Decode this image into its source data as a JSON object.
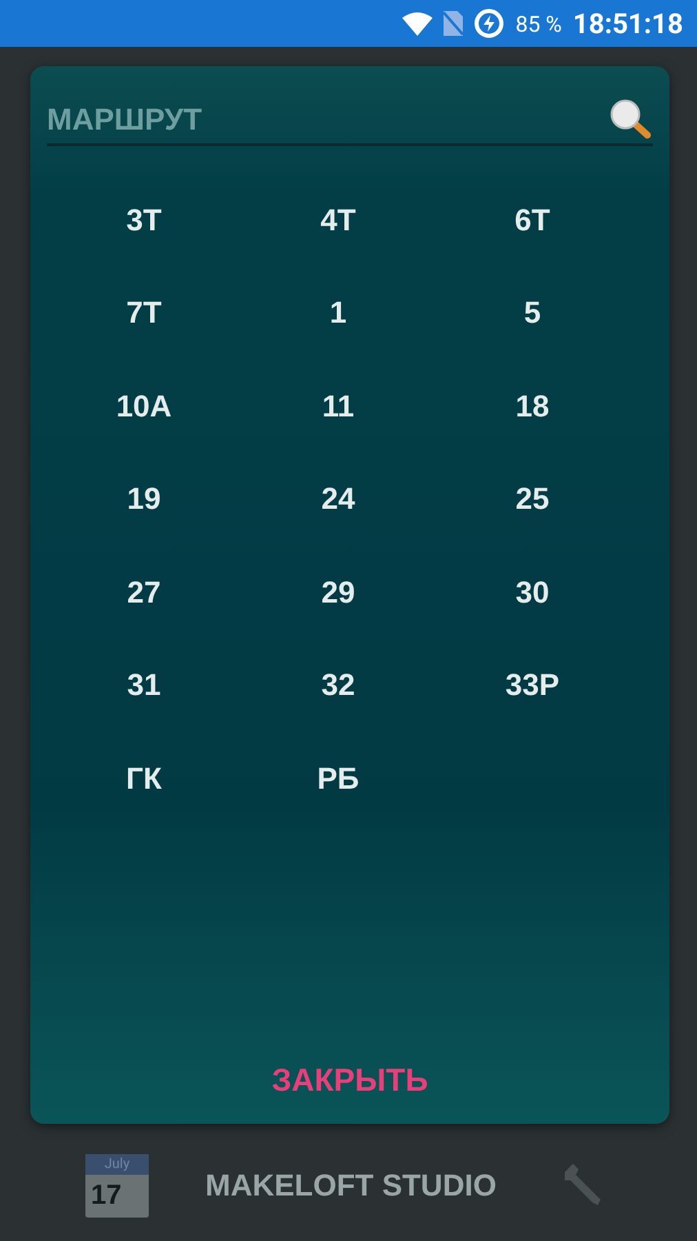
{
  "status_bar": {
    "battery": "85 %",
    "time": "18:51:18"
  },
  "dialog": {
    "search": {
      "placeholder": "МАРШРУТ"
    },
    "routes": [
      "3Т",
      "4Т",
      "6Т",
      "7Т",
      "1",
      "5",
      "10А",
      "11",
      "18",
      "19",
      "24",
      "25",
      "27",
      "29",
      "30",
      "31",
      "32",
      "33Р",
      "ГК",
      "РБ"
    ],
    "close_button": "ЗАКРЫТЬ"
  },
  "bottom_bar": {
    "calendar_month": "July",
    "calendar_day": "17",
    "title": "MAKELOFT STUDIO"
  }
}
